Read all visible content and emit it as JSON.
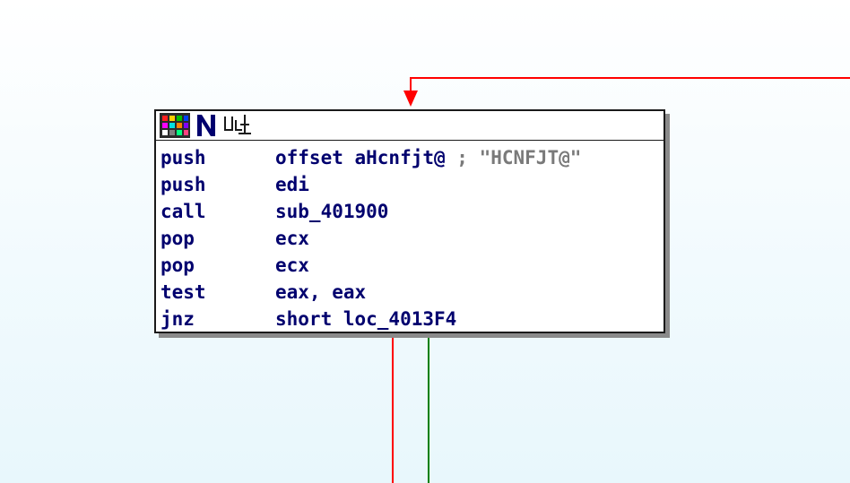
{
  "colors": {
    "edge_red": "#ff0000",
    "edge_green": "#008000",
    "text": "#00006e",
    "comment": "#7a7a7a"
  },
  "node": {
    "header_icons": [
      "color-grid-icon",
      "n-icon",
      "graph-nodes-icon"
    ],
    "lines": [
      {
        "mnemonic": "push",
        "operand": "offset aHcnfjt@",
        "comment": " ; \"HCNFJT@\""
      },
      {
        "mnemonic": "push",
        "operand": "edi",
        "comment": ""
      },
      {
        "mnemonic": "call",
        "operand": "sub_401900",
        "comment": ""
      },
      {
        "mnemonic": "pop",
        "operand": "ecx",
        "comment": ""
      },
      {
        "mnemonic": "pop",
        "operand": "ecx",
        "comment": ""
      },
      {
        "mnemonic": "test",
        "operand": "eax, eax",
        "comment": ""
      },
      {
        "mnemonic": "jnz",
        "operand": "short loc_4013F4",
        "comment": ""
      }
    ]
  }
}
